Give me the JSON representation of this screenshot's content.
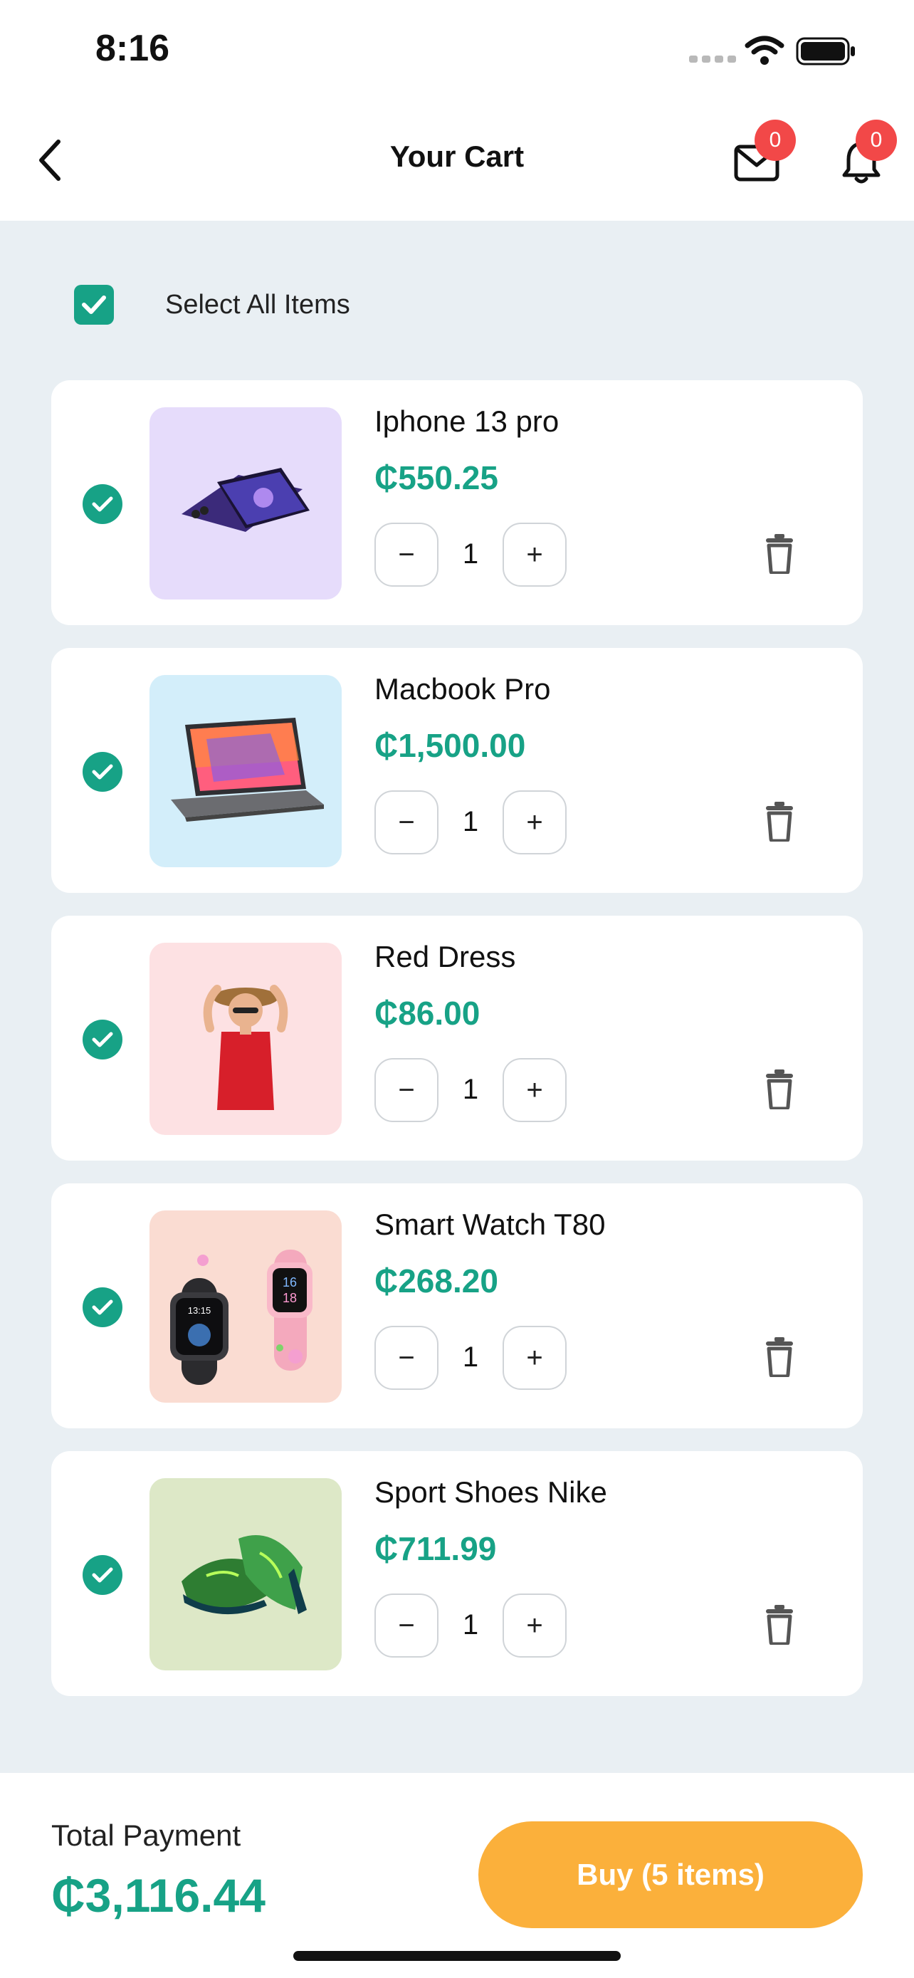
{
  "status_bar": {
    "time": "8:16"
  },
  "header": {
    "title": "Your Cart",
    "mail_badge": "0",
    "notification_badge": "0"
  },
  "select_all": {
    "label": "Select All Items",
    "checked": true
  },
  "items": [
    {
      "name": "Iphone 13 pro",
      "price": "₵550.25",
      "quantity": "1",
      "thumb_bg": "#e6dcfb",
      "image": "phone"
    },
    {
      "name": "Macbook Pro",
      "price": "₵1,500.00",
      "quantity": "1",
      "thumb_bg": "#d3eefa",
      "image": "laptop"
    },
    {
      "name": "Red Dress",
      "price": "₵86.00",
      "quantity": "1",
      "thumb_bg": "#fde1e3",
      "image": "dress"
    },
    {
      "name": "Smart Watch T80",
      "price": "₵268.20",
      "quantity": "1",
      "thumb_bg": "#fadcd2",
      "image": "watch"
    },
    {
      "name": "Sport Shoes Nike",
      "price": "₵711.99",
      "quantity": "1",
      "thumb_bg": "#dde8c7",
      "image": "shoes"
    }
  ],
  "quantity_controls": {
    "minus": "−",
    "plus": "+"
  },
  "footer": {
    "total_label": "Total Payment",
    "total_value": "₵3,116.44",
    "buy_label": "Buy (5 items)"
  },
  "colors": {
    "accent": "#17a286",
    "buy_button": "#fbb03b",
    "badge": "#f24848"
  }
}
